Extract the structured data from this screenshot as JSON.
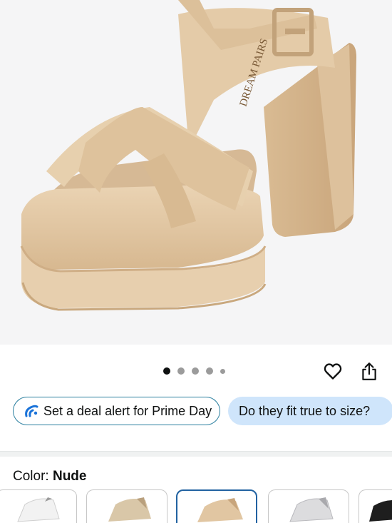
{
  "product": {
    "brand_mark": "DREAM PAIRS",
    "image_pager": {
      "count": 5,
      "active_index": 0
    }
  },
  "icons": {
    "wishlist": "heart-icon",
    "share": "share-icon",
    "deal_alert": "alert-icon"
  },
  "actions": {
    "deal_alert_label": "Set a deal alert for Prime Day",
    "fit_question_label": "Do they fit true to size?"
  },
  "variant": {
    "color_label": "Color: ",
    "color_value": "Nude",
    "swatches": [
      {
        "name": "White",
        "color": "#f2f2f2",
        "selected": false
      },
      {
        "name": "Champagne",
        "color": "#d9c7a8",
        "selected": false
      },
      {
        "name": "Nude",
        "color": "#e1c6a2",
        "selected": true
      },
      {
        "name": "Silver",
        "color": "#cfcfd2",
        "selected": false
      },
      {
        "name": "Black",
        "color": "#1e1e1e",
        "selected": false
      }
    ]
  },
  "colors": {
    "accent_blue": "#2162a1",
    "pill_fit_bg": "#cfe5fb",
    "deal_border": "#2a7f9f",
    "shoe_main": "#e2c9a6"
  }
}
